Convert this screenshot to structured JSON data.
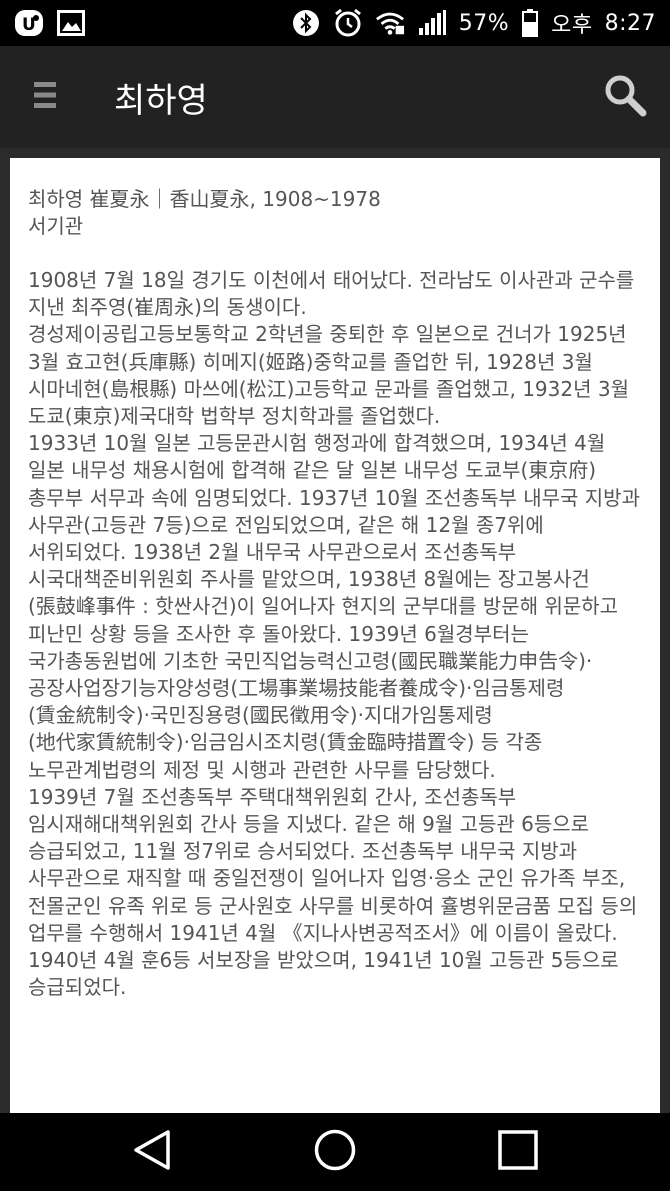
{
  "status_bar": {
    "battery_percent": "57%",
    "ampm": "오후",
    "time": "8:27",
    "icons": [
      "app-badge-icon",
      "gallery-icon",
      "bluetooth-icon",
      "alarm-icon",
      "wifi-icon",
      "signal-icon",
      "battery-icon"
    ]
  },
  "app_bar": {
    "title": "최하영",
    "menu_icon": "hamburger-menu-icon",
    "search_icon": "search-icon"
  },
  "article": {
    "name_line": "최하영 崔夏永｜香山夏永, 1908~1978",
    "role_line": "서기관",
    "paragraphs": [
      "1908년 7월 18일 경기도 이천에서 태어났다. 전라남도 이사관과 군수를 지낸 최주영(崔周永)의 동생이다.",
      "경성제이공립고등보통학교 2학년을 중퇴한 후 일본으로 건너가 1925년 3월 효고현(兵庫縣) 히메지(姬路)중학교를 졸업한 뒤, 1928년 3월 시마네현(島根縣) 마쓰에(松江)고등학교 문과를 졸업했고, 1932년 3월 도쿄(東京)제국대학 법학부 정치학과를 졸업했다.",
      "1933년 10월 일본 고등문관시험 행정과에 합격했으며, 1934년 4월 일본 내무성 채용시험에 합격해 같은 달 일본 내무성 도쿄부(東京府) 총무부 서무과 속에 임명되었다. 1937년 10월 조선총독부 내무국 지방과 사무관(고등관 7등)으로 전임되었으며, 같은 해 12월 종7위에 서위되었다. 1938년 2월 내무국 사무관으로서 조선총독부 시국대책준비위원회 주사를 맡았으며, 1938년 8월에는 장고봉사건(張鼓峰事件 : 핫싼사건)이 일어나자 현지의 군부대를 방문해 위문하고 피난민 상황 등을 조사한 후 돌아왔다. 1939년 6월경부터는 국가총동원법에 기초한 국민직업능력신고령(國民職業能力申告令)·공장사업장기능자양성령(工場事業場技能者養成令)·임금통제령(賃金統制令)·국민징용령(國民徵用令)·지대가임통제령(地代家賃統制令)·임금임시조치령(賃金臨時措置令) 등 각종 노무관계법령의 제정 및 시행과 관련한 사무를 담당했다.",
      "1939년 7월 조선총독부 주택대책위원회 간사, 조선총독부 임시재해대책위원회 간사 등을 지냈다. 같은 해 9월 고등관 6등으로 승급되었고, 11월 정7위로 승서되었다. 조선총독부 내무국 지방과 사무관으로 재직할 때 중일전쟁이 일어나자 입영·응소 군인 유가족 부조, 전몰군인 유족 위로 등 군사원호 사무를 비롯하여 휼병위문금품 모집 등의 업무를 수행해서 1941년 4월 《지나사변공적조서》에 이름이 올랐다. 1940년 4월 훈6등 서보장을 받았으며, 1941년 10월 고등관 5등으로 승급되었다."
    ]
  },
  "nav_bar": {
    "back_icon": "back-triangle-icon",
    "home_icon": "home-circle-icon",
    "recents_icon": "recents-square-icon"
  }
}
